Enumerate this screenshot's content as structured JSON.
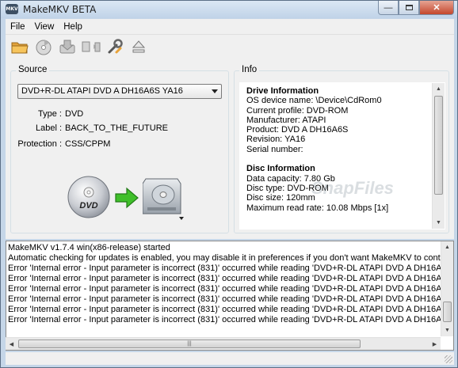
{
  "window": {
    "title": "MakeMKV BETA",
    "app_icon_text": "MKV"
  },
  "menu": [
    "File",
    "View",
    "Help"
  ],
  "toolbar": {
    "icons": [
      "open-files-icon",
      "open-disc-icon",
      "backup-icon",
      "make-mkv-icon",
      "preferences-wrench-icon",
      "eject-icon"
    ]
  },
  "source": {
    "group_label": "Source",
    "drive_selected": "DVD+R-DL ATAPI DVD A  DH16A6S YA16",
    "type_label": "Type :",
    "type_value": "DVD",
    "label_label": "Label :",
    "label_value": "BACK_TO_THE_FUTURE",
    "protection_label": "Protection :",
    "protection_value": "CSS/CPPM",
    "disc_icon_text": "DVD"
  },
  "info": {
    "group_label": "Info",
    "lines": [
      {
        "text": "Drive Information",
        "bold": true
      },
      {
        "text": "OS device name: \\Device\\CdRom0"
      },
      {
        "text": "Current profile: DVD-ROM"
      },
      {
        "text": "Manufacturer: ATAPI"
      },
      {
        "text": "Product: DVD A DH16A6S"
      },
      {
        "text": "Revision: YA16"
      },
      {
        "text": "Serial number:"
      },
      {
        "text": ""
      },
      {
        "text": "Disc Information",
        "bold": true
      },
      {
        "text": "Data capacity: 7.80 Gb"
      },
      {
        "text": "Disc type: DVD-ROM"
      },
      {
        "text": "Disc size: 120mm"
      },
      {
        "text": "Maximum read rate: 10.08 Mbps [1x]"
      }
    ]
  },
  "log": {
    "lines": [
      "MakeMKV v1.7.4 win(x86-release) started",
      "Automatic checking for updates is enabled, you may disable it in preferences if you don't want MakeMKV to contac",
      "Error 'Internal error - Input parameter is incorrect (831)' occurred while reading 'DVD+R-DL ATAPI DVD A DH16A6S Y",
      "Error 'Internal error - Input parameter is incorrect (831)' occurred while reading 'DVD+R-DL ATAPI DVD A DH16A6S Y",
      "Error 'Internal error - Input parameter is incorrect (831)' occurred while reading 'DVD+R-DL ATAPI DVD A DH16A6S Y",
      "Error 'Internal error - Input parameter is incorrect (831)' occurred while reading 'DVD+R-DL ATAPI DVD A DH16A6S Y",
      "Error 'Internal error - Input parameter is incorrect (831)' occurred while reading 'DVD+R-DL ATAPI DVD A DH16A6S Y",
      "Error 'Internal error - Input parameter is incorrect (831)' occurred while reading 'DVD+R-DL ATAPI DVD A DH16A6S Y"
    ]
  },
  "watermark": "SnapFiles",
  "colors": {
    "arrow_green": "#3fbf2a",
    "title_bar": "#c8d9ec",
    "close_red": "#c4472c"
  }
}
